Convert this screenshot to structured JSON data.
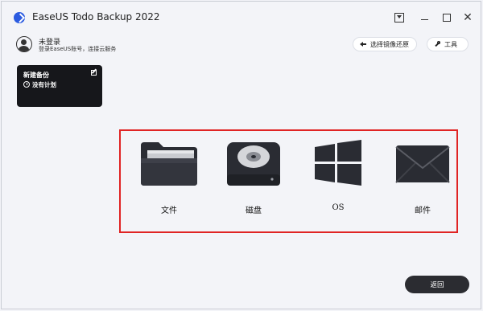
{
  "app": {
    "title": "EaseUS Todo Backup 2022"
  },
  "user": {
    "name": "未登录",
    "subtitle": "登录EaseUS账号，连接云服务"
  },
  "toolbar": {
    "restore_label": "选择镜像还原",
    "tools_label": "工具"
  },
  "plan": {
    "title": "新建备份",
    "status": "没有计划"
  },
  "targets": [
    {
      "label": "文件",
      "icon": "folder-icon"
    },
    {
      "label": "磁盘",
      "icon": "disk-icon"
    },
    {
      "label": "OS",
      "icon": "windows-icon"
    },
    {
      "label": "邮件",
      "icon": "mail-icon"
    }
  ],
  "footer": {
    "back_label": "返回"
  },
  "colors": {
    "highlight_border": "#e02424",
    "dark": "#16171b",
    "accent": "#2b5be0"
  }
}
